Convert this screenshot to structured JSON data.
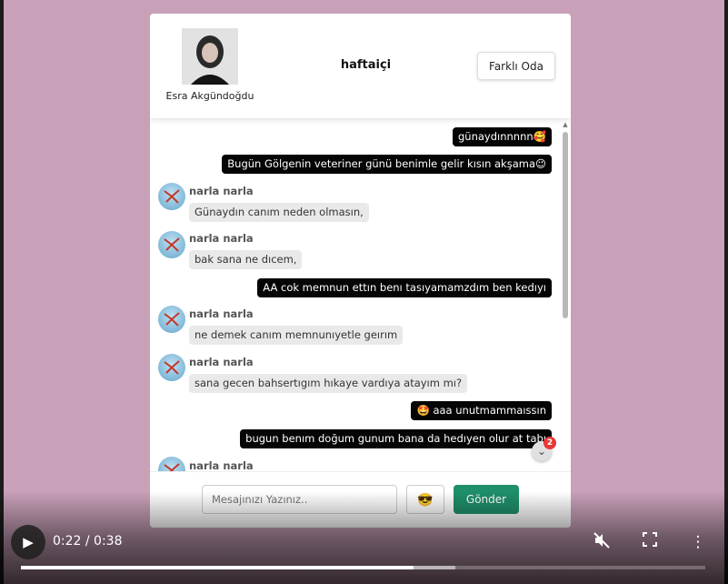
{
  "header": {
    "profile_name": "Esra Akgündoğdu",
    "room_title": "haftaiçi",
    "room_button": "Farklı Oda"
  },
  "messages": [
    {
      "type": "out",
      "text": "günaydınnnnn🥰"
    },
    {
      "type": "out",
      "text": "Bugün Gölgenin veteriner günü benimle gelir kısın akşama😉"
    },
    {
      "type": "in",
      "sender": "narla narla",
      "text": "Günaydın canım neden olmasın,"
    },
    {
      "type": "in",
      "sender": "narla narla",
      "text": "bak sana ne dıcem,"
    },
    {
      "type": "out",
      "text": "AA cok memnun ettın benı tasıyamamzdım ben kedıyı"
    },
    {
      "type": "in",
      "sender": "narla narla",
      "text": "ne demek canım memnunıyetle geırım"
    },
    {
      "type": "in",
      "sender": "narla narla",
      "text": "sana gecen bahsertıgım hıkaye vardıya atayım mı?"
    },
    {
      "type": "out",
      "text": "🤩 aaa unutmammaıssın"
    },
    {
      "type": "out",
      "text": "bugun benım doğum gunum bana da hedıyen olur at tabı"
    },
    {
      "type": "in",
      "sender": "narla narla",
      "text": ""
    }
  ],
  "notification": {
    "icon": "double-chevron-down-icon",
    "count": "2"
  },
  "composer": {
    "placeholder": "Mesajınızı Yazınız..",
    "emoji": "😎",
    "send_label": "Gönder"
  },
  "player": {
    "time": "0:22 / 0:38",
    "progress": 0.574,
    "buffered": 0.635
  },
  "colors": {
    "background": "#c8a0b8",
    "send_button": "#1f8f6b",
    "outgoing_bubble": "#050505",
    "incoming_bubble": "#e9e9e9",
    "badge": "#e53935"
  }
}
